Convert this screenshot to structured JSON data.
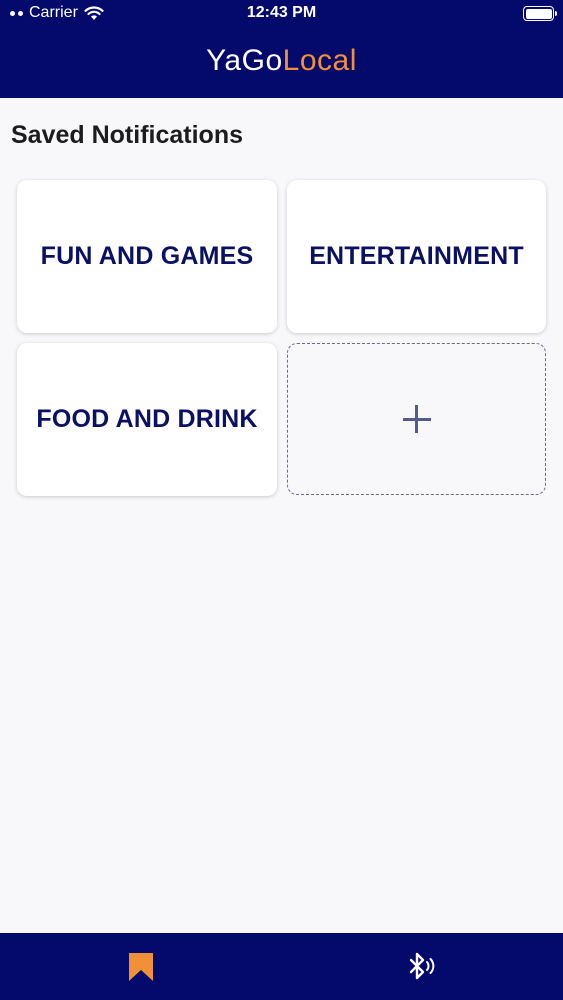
{
  "status_bar": {
    "carrier": "Carrier",
    "time": "12:43 PM"
  },
  "header": {
    "logo_part1": "YaGo",
    "logo_part2": "Local",
    "logo_color_primary": "#ffffff",
    "logo_color_accent": "#f0913a",
    "background": "#030a6b"
  },
  "page": {
    "title": "Saved Notifications"
  },
  "categories": [
    {
      "label": "FUN AND GAMES"
    },
    {
      "label": "ENTERTAINMENT"
    },
    {
      "label": "FOOD AND DRINK"
    }
  ],
  "add_card": {
    "icon": "plus-icon"
  },
  "tabbar": {
    "items": [
      {
        "icon": "bookmark-icon",
        "active": true,
        "color": "#f0913a"
      },
      {
        "icon": "bluetooth-icon",
        "active": false,
        "color": "#ffffff"
      }
    ]
  }
}
